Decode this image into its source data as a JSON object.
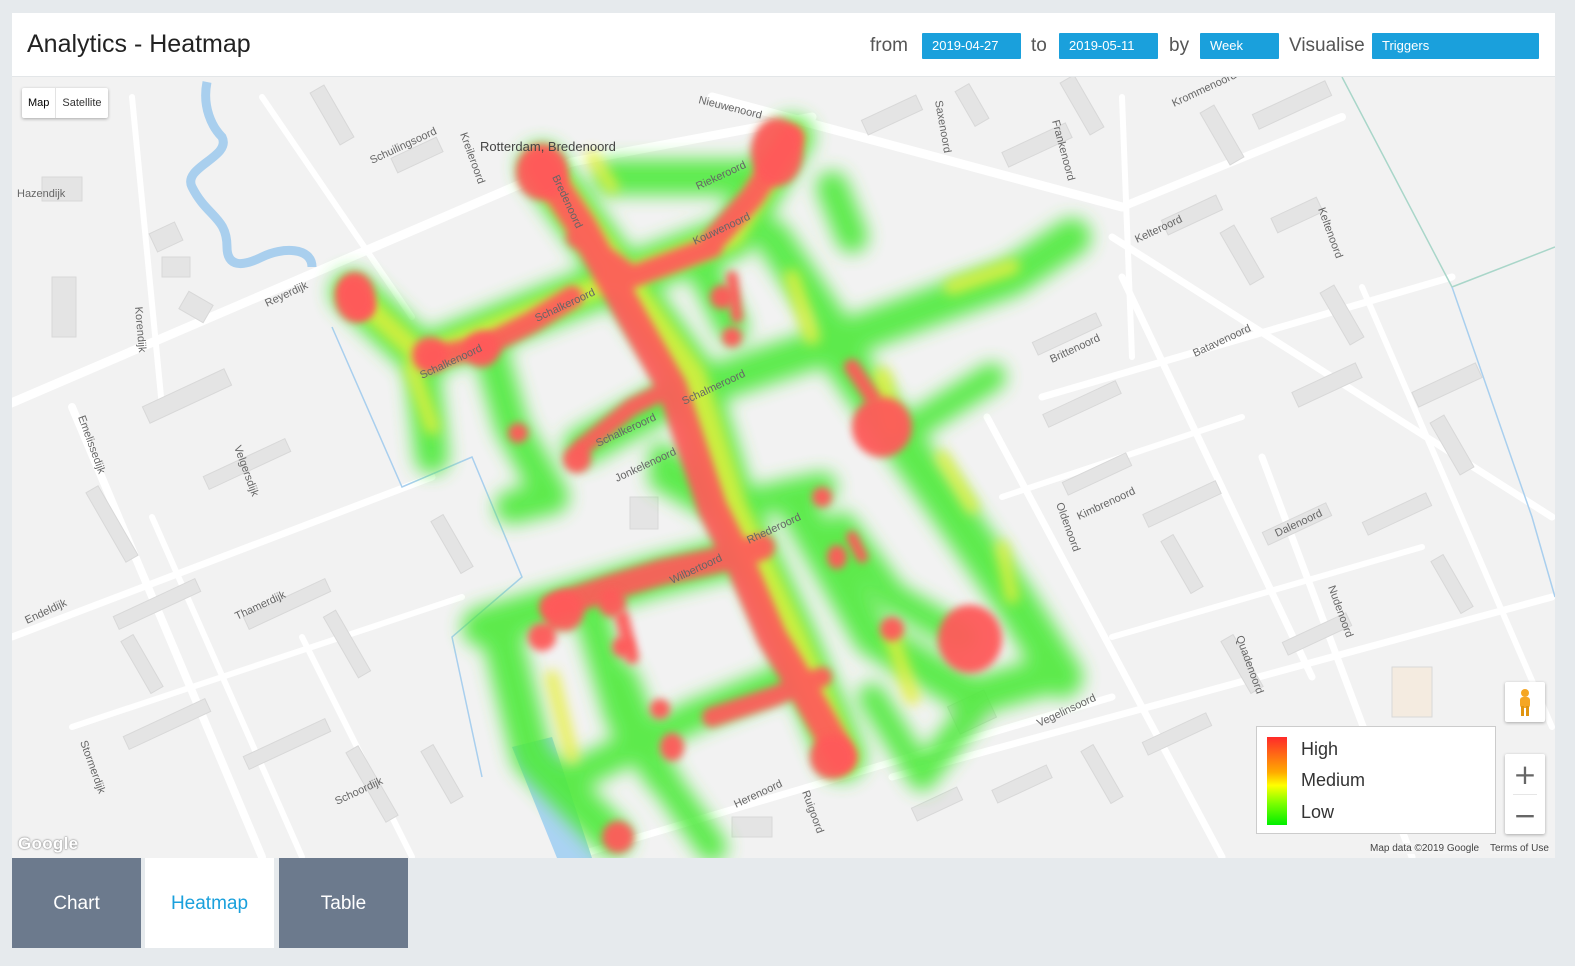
{
  "header": {
    "title": "Analytics - Heatmap",
    "from_label": "from",
    "from_value": "2019-04-27",
    "to_label": "to",
    "to_value": "2019-05-11",
    "by_label": "by",
    "by_value": "Week",
    "visualise_label": "Visualise",
    "visualise_value": "Triggers"
  },
  "map": {
    "type_options": [
      "Map",
      "Satellite"
    ],
    "selected_type": "Map",
    "place_label": "Rotterdam, Bredenoord",
    "streets": [
      "Nieuwenoord",
      "Schuilingsoord",
      "Kreileroord",
      "Hazendijk",
      "Reyerdijk",
      "Korendijk",
      "Bredenoord",
      "Riekeroord",
      "Kouwenoord",
      "Schalkeroord",
      "Schalkenoord",
      "Schalmeroord",
      "Schalkeroord",
      "Jonkelenoord",
      "Rhederoord",
      "Wilbertoord",
      "Saxenoord",
      "Frankenoord",
      "Kelteroord",
      "Krommenoord",
      "Batavenoord",
      "Brittenoord",
      "Oldenoord",
      "Kimbrenoord",
      "Dalenoord",
      "Nudenoord",
      "Quadenoord",
      "Vegelinsoord",
      "Herenoord",
      "Ruigoord",
      "Velgersdijk",
      "Emelissedijk",
      "Endeldijk",
      "Thamerdijk",
      "Stormerdijk",
      "Schoordijk",
      "Keltenoord"
    ],
    "legend": {
      "high": "High",
      "medium": "Medium",
      "low": "Low",
      "colors": [
        "#ff2a2a",
        "#ffff00",
        "#00ee00"
      ]
    },
    "google_logo": "Google",
    "map_data": "Map data ©2019 Google",
    "terms": "Terms of Use",
    "pegman_icon": "pegman-icon",
    "zoom_in_icon": "plus-icon",
    "zoom_out_icon": "minus-icon"
  },
  "tabs": [
    {
      "label": "Chart",
      "active": false
    },
    {
      "label": "Heatmap",
      "active": true
    },
    {
      "label": "Table",
      "active": false
    }
  ]
}
